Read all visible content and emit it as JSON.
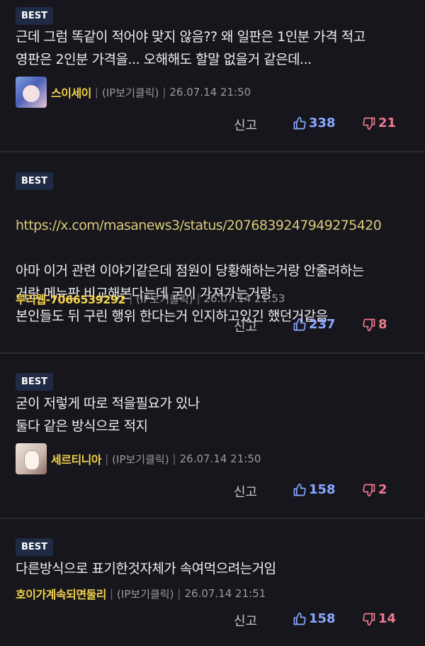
{
  "comments": [
    {
      "badge": "BEST",
      "text": "근데 그럼 똑같이 적어야 맞지 않음?? 왜 일판은 1인분 가격 적고\n영판은 2인분 가격을... 오해해도 할말 없을거 같은데...",
      "nick": "스이세이",
      "ip": "(IP보기클릭)",
      "date": "26.07.14 21:50",
      "report": "신고",
      "up": "338",
      "down": "21"
    },
    {
      "badge": "BEST",
      "link": "https://x.com/masanews3/status/2076839247949275420",
      "text": "아마 이거 관련 이야기같은데 점원이 당황해하는거랑 안줄려하는\n거랑 메뉴판 비교해본다는데 굳이 가져가는거랑\n본인들도 뒤 구린 행위 한다는거 인지하고있긴 했던거같음",
      "nick": "루리웹-7066539292",
      "ip": "(IP보기클릭)",
      "date": "26.07.14 21:53",
      "report": "신고",
      "up": "237",
      "down": "8"
    },
    {
      "badge": "BEST",
      "text": "굳이 저렇게 따로 적을필요가 있나\n둘다 같은 방식으로 적지",
      "nick": "세르티니아",
      "ip": "(IP보기클릭)",
      "date": "26.07.14 21:50",
      "report": "신고",
      "up": "158",
      "down": "2"
    },
    {
      "badge": "BEST",
      "text": "다른방식으로 표기한것자체가 속여먹으려는거임",
      "nick": "호이가계속되면둘리",
      "ip": "(IP보기클릭)",
      "date": "26.07.14 21:51",
      "report": "신고",
      "up": "158",
      "down": "14"
    }
  ]
}
